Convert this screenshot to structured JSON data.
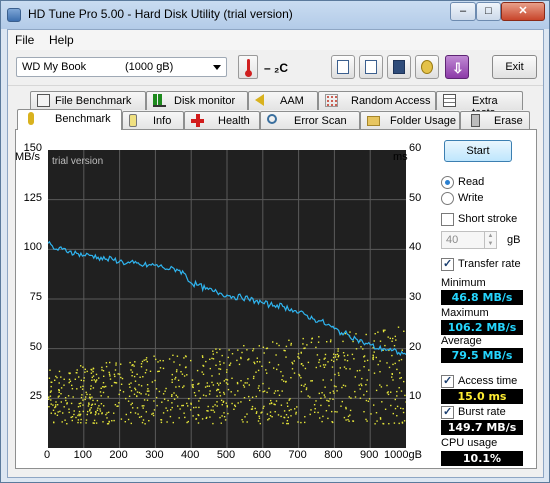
{
  "window": {
    "title": "HD Tune Pro 5.00 - Hard Disk Utility (trial version)"
  },
  "menu": {
    "file": "File",
    "help": "Help"
  },
  "toolbar": {
    "drive_name": "WD My Book",
    "drive_size": "(1000 gB)",
    "temperature": "– ₂C",
    "exit_label": "Exit"
  },
  "tabs_top": [
    {
      "label": "File Benchmark"
    },
    {
      "label": "Disk monitor"
    },
    {
      "label": "AAM"
    },
    {
      "label": "Random Access"
    },
    {
      "label": "Extra tests"
    }
  ],
  "tabs_bottom": [
    {
      "label": "Benchmark"
    },
    {
      "label": "Info"
    },
    {
      "label": "Health"
    },
    {
      "label": "Error Scan"
    },
    {
      "label": "Folder Usage"
    },
    {
      "label": "Erase"
    }
  ],
  "side": {
    "start_label": "Start",
    "read_label": "Read",
    "write_label": "Write",
    "short_stroke_label": "Short stroke",
    "short_stroke_value": "40",
    "short_stroke_unit": "gB",
    "transfer_rate_label": "Transfer rate",
    "minimum_label": "Minimum",
    "minimum_value": "46.8 MB/s",
    "maximum_label": "Maximum",
    "maximum_value": "106.2 MB/s",
    "average_label": "Average",
    "average_value": "79.5 MB/s",
    "access_time_label": "Access time",
    "access_time_value": "15.0 ms",
    "burst_rate_label": "Burst rate",
    "burst_rate_value": "149.7 MB/s",
    "cpu_usage_label": "CPU usage",
    "cpu_usage_value": "10.1%"
  },
  "chart_data": {
    "type": "line",
    "watermark": "trial version",
    "ylabel_left": "MB/s",
    "ylabel_right": "ms",
    "y_ticks_left": [
      "150",
      "125",
      "100",
      "75",
      "50",
      "25"
    ],
    "y_ticks_right": [
      "60",
      "50",
      "40",
      "30",
      "20",
      "10"
    ],
    "x_ticks": [
      "0",
      "100",
      "200",
      "300",
      "400",
      "500",
      "600",
      "700",
      "800",
      "900",
      "1000gB"
    ],
    "xlim": [
      0,
      1000
    ],
    "ylim_left": [
      0,
      150
    ],
    "ylim_right": [
      0,
      60
    ],
    "grid": true,
    "colors": {
      "transfer": "#2fb4ef",
      "access": "#e8e83a",
      "background": "#202020",
      "grid": "#5a5a5a"
    },
    "transfer_rate": [
      [
        0,
        103
      ],
      [
        20,
        100
      ],
      [
        40,
        100
      ],
      [
        60,
        99
      ],
      [
        80,
        98
      ],
      [
        100,
        97
      ],
      [
        120,
        97
      ],
      [
        140,
        96
      ],
      [
        160,
        95
      ],
      [
        180,
        95
      ],
      [
        200,
        94
      ],
      [
        220,
        93
      ],
      [
        240,
        93
      ],
      [
        260,
        92
      ],
      [
        280,
        92
      ],
      [
        300,
        92
      ],
      [
        320,
        91
      ],
      [
        340,
        90
      ],
      [
        360,
        90
      ],
      [
        380,
        88
      ],
      [
        400,
        83
      ],
      [
        420,
        82
      ],
      [
        440,
        80
      ],
      [
        460,
        79
      ],
      [
        480,
        78
      ],
      [
        500,
        77
      ],
      [
        520,
        76
      ],
      [
        540,
        76
      ],
      [
        560,
        75
      ],
      [
        580,
        74
      ],
      [
        600,
        73
      ],
      [
        620,
        72
      ],
      [
        640,
        72
      ],
      [
        660,
        71
      ],
      [
        680,
        70
      ],
      [
        700,
        68
      ],
      [
        720,
        67
      ],
      [
        740,
        65
      ],
      [
        760,
        64
      ],
      [
        780,
        62
      ],
      [
        800,
        60
      ],
      [
        820,
        58
      ],
      [
        840,
        57
      ],
      [
        860,
        55
      ],
      [
        880,
        53
      ],
      [
        900,
        52
      ],
      [
        920,
        50
      ],
      [
        940,
        50
      ],
      [
        960,
        49
      ],
      [
        980,
        48
      ],
      [
        1000,
        47
      ]
    ],
    "access_time_band_ms": {
      "min": 5,
      "max": 25
    }
  }
}
